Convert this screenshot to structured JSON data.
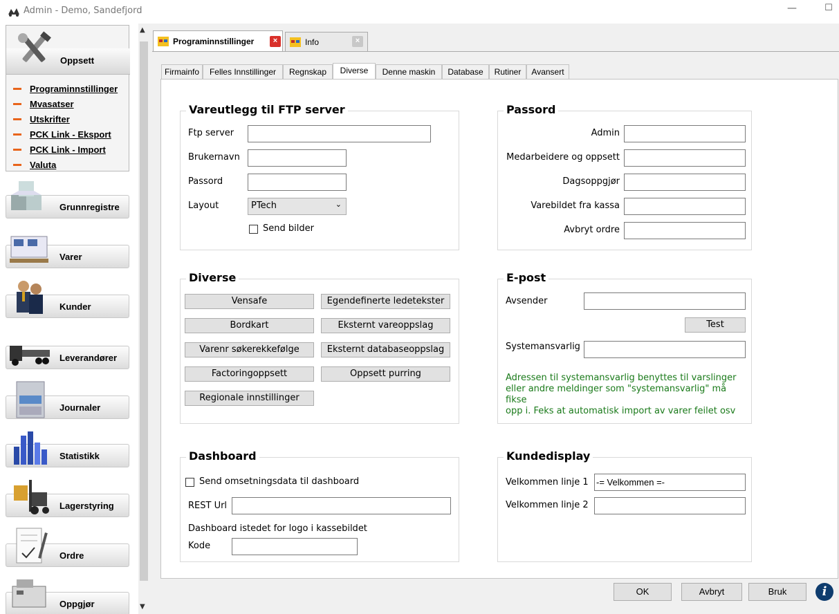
{
  "window": {
    "title": "Admin - Demo, Sandefjord",
    "minimize_glyph": "—",
    "maximize_glyph": "☐"
  },
  "sidebar": {
    "groups": [
      {
        "label": "Oppsett",
        "icon": "tools-icon"
      },
      {
        "label": "Grunnregistre",
        "icon": "cubes-icon"
      },
      {
        "label": "Varer",
        "icon": "pallet-icon"
      },
      {
        "label": "Kunder",
        "icon": "people-icon"
      },
      {
        "label": "Leverandører",
        "icon": "truck-icon"
      },
      {
        "label": "Journaler",
        "icon": "cabinet-icon"
      },
      {
        "label": "Statistikk",
        "icon": "bar-chart-icon"
      },
      {
        "label": "Lagerstyring",
        "icon": "forklift-icon"
      },
      {
        "label": "Ordre",
        "icon": "document-icon"
      },
      {
        "label": "Oppgjør",
        "icon": "cash-register-icon"
      }
    ],
    "oppsett_items": [
      "Programinnstillinger",
      "Mvasatser",
      "Utskrifter",
      "PCK Link - Eksport",
      "PCK Link - Import",
      "Valuta"
    ]
  },
  "doc_tabs": [
    {
      "label": "Programinnstillinger",
      "close": "×"
    },
    {
      "label": "Info",
      "close": "×"
    }
  ],
  "sub_tabs": [
    "Firmainfo",
    "Felles Innstillinger",
    "Regnskap",
    "Diverse",
    "Denne maskin",
    "Database",
    "Rutiner",
    "Avansert"
  ],
  "ftp": {
    "title": "Vareutlegg til FTP server",
    "server_label": "Ftp server",
    "server_value": "",
    "user_label": "Brukernavn",
    "user_value": "",
    "pass_label": "Passord",
    "pass_value": "",
    "layout_label": "Layout",
    "layout_value": "PTech",
    "send_bilder_label": "Send bilder"
  },
  "passord": {
    "title": "Passord",
    "fields": [
      {
        "label": "Admin",
        "value": ""
      },
      {
        "label": "Medarbeidere og oppsett",
        "value": ""
      },
      {
        "label": "Dagsoppgjør",
        "value": ""
      },
      {
        "label": "Varebildet fra kassa",
        "value": ""
      },
      {
        "label": "Avbryt ordre",
        "value": ""
      }
    ]
  },
  "diverse": {
    "title": "Diverse",
    "buttons": [
      "Vensafe",
      "Egendefinerte ledetekster",
      "Bordkart",
      "Eksternt vareoppslag",
      "Varenr søkerekkefølge",
      "Eksternt databaseoppslag",
      "Factoringoppsett",
      "Oppsett purring",
      "Regionale innstillinger"
    ]
  },
  "epost": {
    "title": "E-post",
    "avsender_label": "Avsender",
    "avsender_value": "",
    "test_label": "Test",
    "system_label": "Systemansvarlig",
    "system_value": "",
    "note_lines": [
      "Adressen til systemansvarlig benyttes til varslinger",
      "eller andre meldinger som \"systemansvarlig\" må fikse",
      "opp i. Feks at automatisk import av varer feilet osv"
    ]
  },
  "dashboard": {
    "title": "Dashboard",
    "send_label": "Send omsetningsdata til dashboard",
    "rest_label": "REST Url",
    "rest_value": "",
    "logo_label": "Dashboard istedet for logo i kassebildet",
    "kode_label": "Kode",
    "kode_value": ""
  },
  "kundedisplay": {
    "title": "Kundedisplay",
    "line1_label": "Velkommen linje 1",
    "line1_value": "-= Velkommen =-",
    "line2_label": "Velkommen linje 2",
    "line2_value": ""
  },
  "footer": {
    "ok": "OK",
    "avbryt": "Avbryt",
    "bruk": "Bruk",
    "info_glyph": "i"
  }
}
